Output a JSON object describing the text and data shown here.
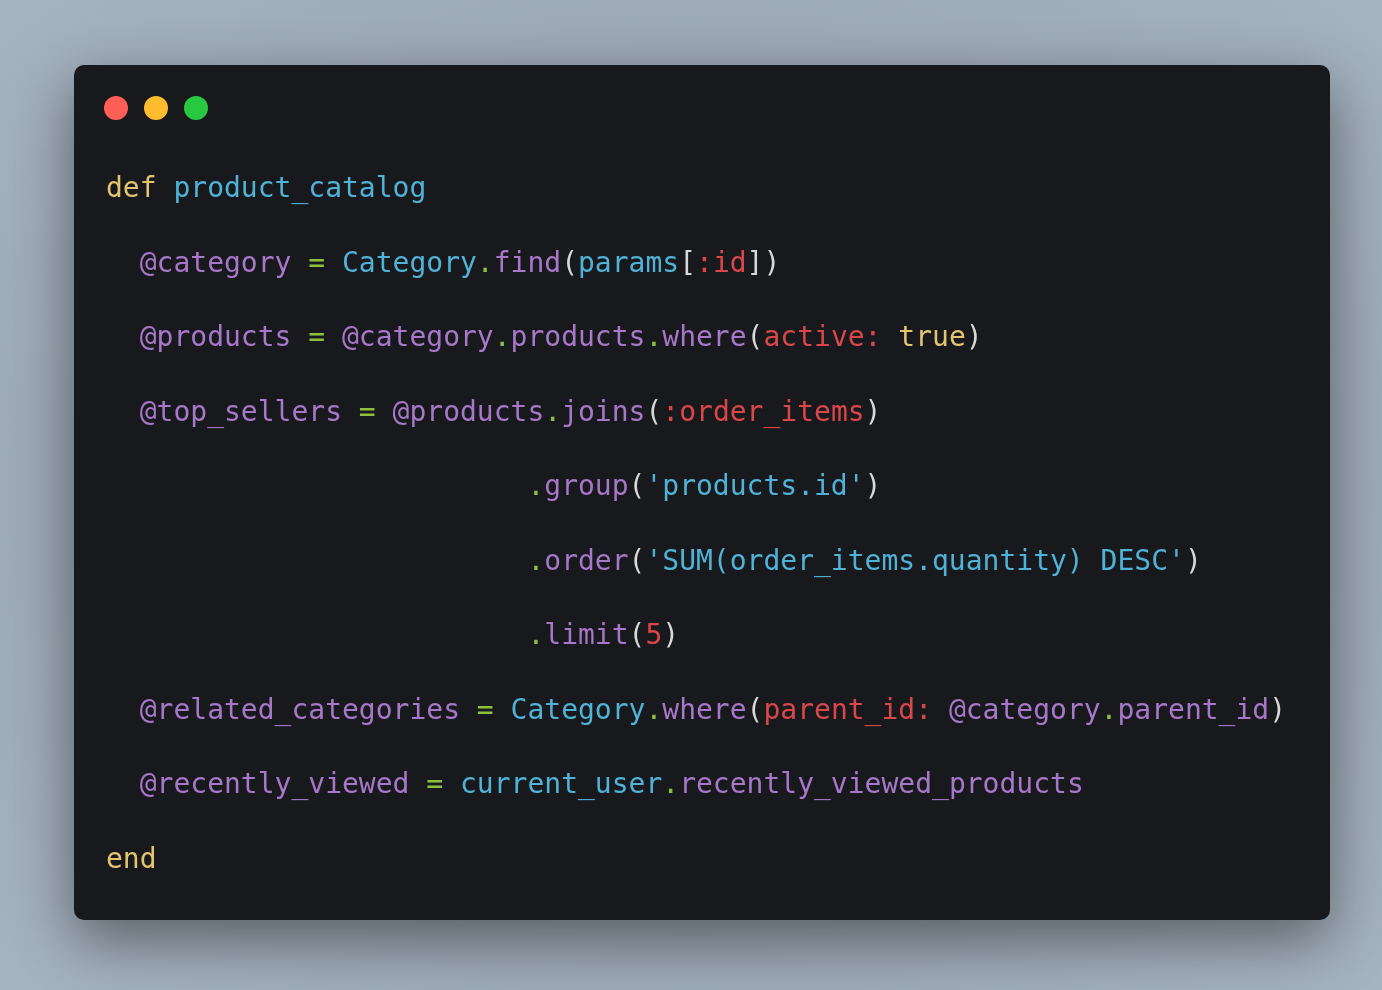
{
  "window": {
    "controls": [
      {
        "kind": "close"
      },
      {
        "kind": "minimize"
      },
      {
        "kind": "zoom"
      }
    ]
  },
  "code": {
    "lines": [
      {
        "kind": "top",
        "tokens": [
          {
            "text": "def ",
            "kind": "keyword"
          },
          {
            "text": "product_catalog",
            "kind": "name"
          }
        ]
      },
      {
        "kind": "body",
        "tokens": [
          {
            "text": "@category",
            "kind": "ivar"
          },
          {
            "text": " = ",
            "kind": "op"
          },
          {
            "text": "Category",
            "kind": "name"
          },
          {
            "text": ".",
            "kind": "op"
          },
          {
            "text": "find",
            "kind": "method"
          },
          {
            "text": "(",
            "kind": "plain"
          },
          {
            "text": "params",
            "kind": "name"
          },
          {
            "text": "[",
            "kind": "plain"
          },
          {
            "text": ":id",
            "kind": "symbol"
          },
          {
            "text": "])",
            "kind": "plain"
          }
        ]
      },
      {
        "kind": "body",
        "tokens": [
          {
            "text": "@products",
            "kind": "ivar"
          },
          {
            "text": " = ",
            "kind": "op"
          },
          {
            "text": "@category",
            "kind": "ivar"
          },
          {
            "text": ".",
            "kind": "op"
          },
          {
            "text": "products",
            "kind": "method"
          },
          {
            "text": ".",
            "kind": "op"
          },
          {
            "text": "where",
            "kind": "method"
          },
          {
            "text": "(",
            "kind": "plain"
          },
          {
            "text": "active: ",
            "kind": "symbol"
          },
          {
            "text": "true",
            "kind": "keyword"
          },
          {
            "text": ")",
            "kind": "plain"
          }
        ]
      },
      {
        "kind": "body",
        "tokens": [
          {
            "text": "@top_sellers",
            "kind": "ivar"
          },
          {
            "text": " = ",
            "kind": "op"
          },
          {
            "text": "@products",
            "kind": "ivar"
          },
          {
            "text": ".",
            "kind": "op"
          },
          {
            "text": "joins",
            "kind": "method"
          },
          {
            "text": "(",
            "kind": "plain"
          },
          {
            "text": ":order_items",
            "kind": "symbol"
          },
          {
            "text": ")",
            "kind": "plain"
          }
        ]
      },
      {
        "kind": "continuation",
        "tokens": [
          {
            "text": ".group",
            "kind": "chain"
          },
          {
            "text": "(",
            "kind": "plain"
          },
          {
            "text": "'products.id'",
            "kind": "string"
          },
          {
            "text": ")",
            "kind": "plain"
          }
        ]
      },
      {
        "kind": "continuation",
        "tokens": [
          {
            "text": ".order",
            "kind": "chain"
          },
          {
            "text": "(",
            "kind": "plain"
          },
          {
            "text": "'SUM(order_items.quantity) DESC'",
            "kind": "string"
          },
          {
            "text": ")",
            "kind": "plain"
          }
        ]
      },
      {
        "kind": "continuation",
        "tokens": [
          {
            "text": ".limit",
            "kind": "chain"
          },
          {
            "text": "(",
            "kind": "plain"
          },
          {
            "text": "5",
            "kind": "symbol"
          },
          {
            "text": ")",
            "kind": "plain"
          }
        ]
      },
      {
        "kind": "body",
        "tokens": [
          {
            "text": "@related_categories",
            "kind": "ivar"
          },
          {
            "text": " = ",
            "kind": "op"
          },
          {
            "text": "Category",
            "kind": "name"
          },
          {
            "text": ".",
            "kind": "op"
          },
          {
            "text": "where",
            "kind": "method"
          },
          {
            "text": "(",
            "kind": "plain"
          },
          {
            "text": "parent_id: ",
            "kind": "symbol"
          },
          {
            "text": "@category",
            "kind": "ivar"
          },
          {
            "text": ".",
            "kind": "op"
          },
          {
            "text": "parent_id",
            "kind": "method"
          },
          {
            "text": ")",
            "kind": "plain"
          }
        ]
      },
      {
        "kind": "body",
        "tokens": [
          {
            "text": "@recently_viewed",
            "kind": "ivar"
          },
          {
            "text": " = ",
            "kind": "op"
          },
          {
            "text": "current_user",
            "kind": "name"
          },
          {
            "text": ".",
            "kind": "op"
          },
          {
            "text": "recently_viewed_products",
            "kind": "method"
          }
        ]
      },
      {
        "kind": "top",
        "tokens": [
          {
            "text": "end",
            "kind": "keyword"
          }
        ]
      }
    ]
  }
}
